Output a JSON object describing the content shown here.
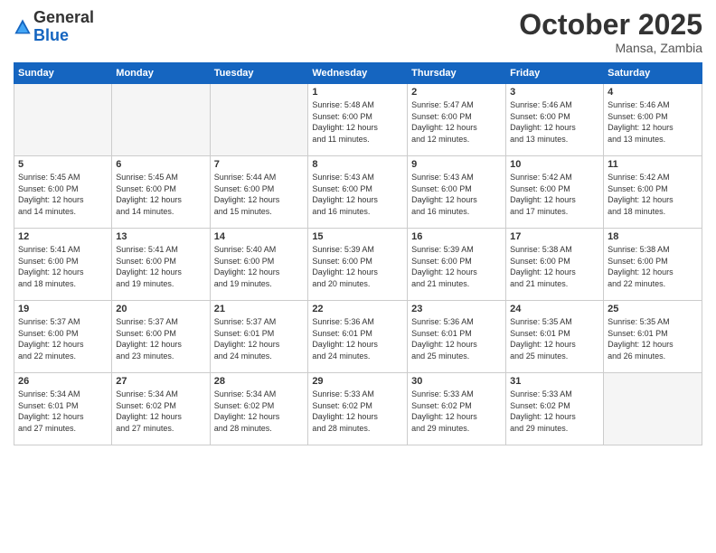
{
  "logo": {
    "general": "General",
    "blue": "Blue"
  },
  "header": {
    "month": "October 2025",
    "location": "Mansa, Zambia"
  },
  "days_of_week": [
    "Sunday",
    "Monday",
    "Tuesday",
    "Wednesday",
    "Thursday",
    "Friday",
    "Saturday"
  ],
  "weeks": [
    [
      {
        "day": "",
        "info": ""
      },
      {
        "day": "",
        "info": ""
      },
      {
        "day": "",
        "info": ""
      },
      {
        "day": "1",
        "info": "Sunrise: 5:48 AM\nSunset: 6:00 PM\nDaylight: 12 hours\nand 11 minutes."
      },
      {
        "day": "2",
        "info": "Sunrise: 5:47 AM\nSunset: 6:00 PM\nDaylight: 12 hours\nand 12 minutes."
      },
      {
        "day": "3",
        "info": "Sunrise: 5:46 AM\nSunset: 6:00 PM\nDaylight: 12 hours\nand 13 minutes."
      },
      {
        "day": "4",
        "info": "Sunrise: 5:46 AM\nSunset: 6:00 PM\nDaylight: 12 hours\nand 13 minutes."
      }
    ],
    [
      {
        "day": "5",
        "info": "Sunrise: 5:45 AM\nSunset: 6:00 PM\nDaylight: 12 hours\nand 14 minutes."
      },
      {
        "day": "6",
        "info": "Sunrise: 5:45 AM\nSunset: 6:00 PM\nDaylight: 12 hours\nand 14 minutes."
      },
      {
        "day": "7",
        "info": "Sunrise: 5:44 AM\nSunset: 6:00 PM\nDaylight: 12 hours\nand 15 minutes."
      },
      {
        "day": "8",
        "info": "Sunrise: 5:43 AM\nSunset: 6:00 PM\nDaylight: 12 hours\nand 16 minutes."
      },
      {
        "day": "9",
        "info": "Sunrise: 5:43 AM\nSunset: 6:00 PM\nDaylight: 12 hours\nand 16 minutes."
      },
      {
        "day": "10",
        "info": "Sunrise: 5:42 AM\nSunset: 6:00 PM\nDaylight: 12 hours\nand 17 minutes."
      },
      {
        "day": "11",
        "info": "Sunrise: 5:42 AM\nSunset: 6:00 PM\nDaylight: 12 hours\nand 18 minutes."
      }
    ],
    [
      {
        "day": "12",
        "info": "Sunrise: 5:41 AM\nSunset: 6:00 PM\nDaylight: 12 hours\nand 18 minutes."
      },
      {
        "day": "13",
        "info": "Sunrise: 5:41 AM\nSunset: 6:00 PM\nDaylight: 12 hours\nand 19 minutes."
      },
      {
        "day": "14",
        "info": "Sunrise: 5:40 AM\nSunset: 6:00 PM\nDaylight: 12 hours\nand 19 minutes."
      },
      {
        "day": "15",
        "info": "Sunrise: 5:39 AM\nSunset: 6:00 PM\nDaylight: 12 hours\nand 20 minutes."
      },
      {
        "day": "16",
        "info": "Sunrise: 5:39 AM\nSunset: 6:00 PM\nDaylight: 12 hours\nand 21 minutes."
      },
      {
        "day": "17",
        "info": "Sunrise: 5:38 AM\nSunset: 6:00 PM\nDaylight: 12 hours\nand 21 minutes."
      },
      {
        "day": "18",
        "info": "Sunrise: 5:38 AM\nSunset: 6:00 PM\nDaylight: 12 hours\nand 22 minutes."
      }
    ],
    [
      {
        "day": "19",
        "info": "Sunrise: 5:37 AM\nSunset: 6:00 PM\nDaylight: 12 hours\nand 22 minutes."
      },
      {
        "day": "20",
        "info": "Sunrise: 5:37 AM\nSunset: 6:00 PM\nDaylight: 12 hours\nand 23 minutes."
      },
      {
        "day": "21",
        "info": "Sunrise: 5:37 AM\nSunset: 6:01 PM\nDaylight: 12 hours\nand 24 minutes."
      },
      {
        "day": "22",
        "info": "Sunrise: 5:36 AM\nSunset: 6:01 PM\nDaylight: 12 hours\nand 24 minutes."
      },
      {
        "day": "23",
        "info": "Sunrise: 5:36 AM\nSunset: 6:01 PM\nDaylight: 12 hours\nand 25 minutes."
      },
      {
        "day": "24",
        "info": "Sunrise: 5:35 AM\nSunset: 6:01 PM\nDaylight: 12 hours\nand 25 minutes."
      },
      {
        "day": "25",
        "info": "Sunrise: 5:35 AM\nSunset: 6:01 PM\nDaylight: 12 hours\nand 26 minutes."
      }
    ],
    [
      {
        "day": "26",
        "info": "Sunrise: 5:34 AM\nSunset: 6:01 PM\nDaylight: 12 hours\nand 27 minutes."
      },
      {
        "day": "27",
        "info": "Sunrise: 5:34 AM\nSunset: 6:02 PM\nDaylight: 12 hours\nand 27 minutes."
      },
      {
        "day": "28",
        "info": "Sunrise: 5:34 AM\nSunset: 6:02 PM\nDaylight: 12 hours\nand 28 minutes."
      },
      {
        "day": "29",
        "info": "Sunrise: 5:33 AM\nSunset: 6:02 PM\nDaylight: 12 hours\nand 28 minutes."
      },
      {
        "day": "30",
        "info": "Sunrise: 5:33 AM\nSunset: 6:02 PM\nDaylight: 12 hours\nand 29 minutes."
      },
      {
        "day": "31",
        "info": "Sunrise: 5:33 AM\nSunset: 6:02 PM\nDaylight: 12 hours\nand 29 minutes."
      },
      {
        "day": "",
        "info": ""
      }
    ]
  ]
}
